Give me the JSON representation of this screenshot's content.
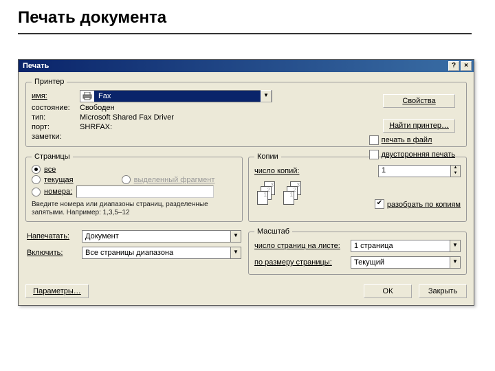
{
  "slide": {
    "title": "Печать документа"
  },
  "titlebar": {
    "title": "Печать",
    "help_glyph": "?",
    "close_glyph": "×"
  },
  "printer_group": {
    "legend": "Принтер",
    "name_label": "имя:",
    "name_value": "Fax",
    "state_label": "состояние:",
    "state_value": "Свободен",
    "type_label": "тип:",
    "type_value": "Microsoft Shared Fax Driver",
    "port_label": "порт:",
    "port_value": "SHRFAX:",
    "notes_label": "заметки:"
  },
  "buttons": {
    "properties": "Свойства",
    "find_printer": "Найти принтер…",
    "options": "Параметры…",
    "ok": "ОК",
    "close": "Закрыть"
  },
  "checks": {
    "to_file": "печать в файл",
    "duplex": "двусторонняя печать"
  },
  "pages_group": {
    "legend": "Страницы",
    "all": "все",
    "current": "текущая",
    "selection": "выделенный фрагмент",
    "numbers": "номера:",
    "hint": "Введите номера или диапазоны страниц, разделенные запятыми. Например: 1,3,5–12"
  },
  "copies_group": {
    "legend": "Копии",
    "count_label": "число копий:",
    "count_value": "1",
    "collate": "разобрать по копиям",
    "stack": {
      "a1": "1",
      "a2": "2",
      "a3": "3"
    }
  },
  "what": {
    "print_label": "Напечатать:",
    "print_value": "Документ",
    "include_label": "Включить:",
    "include_value": "Все страницы диапазона"
  },
  "scale_group": {
    "legend": "Масштаб",
    "pages_per_sheet_label": "число страниц на листе:",
    "pages_per_sheet_value": "1 страница",
    "fit_label": "по размеру страницы:",
    "fit_value": "Текущий"
  }
}
